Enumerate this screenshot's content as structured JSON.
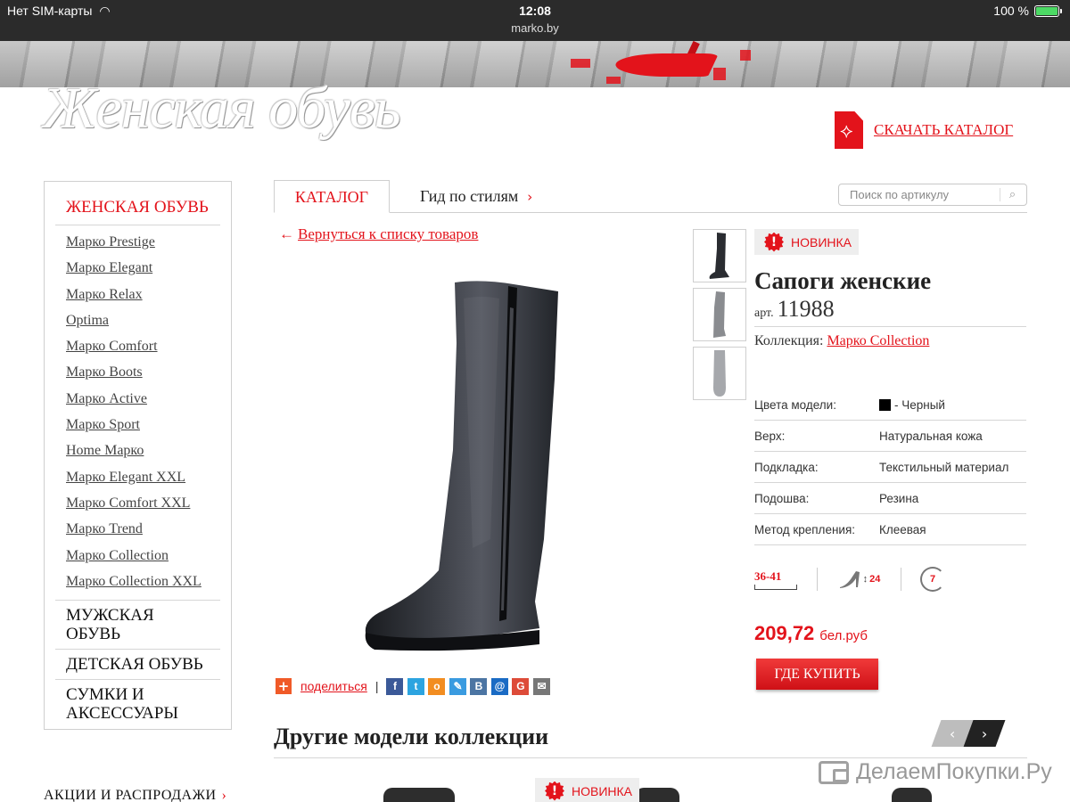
{
  "status_bar": {
    "carrier": "Нет SIM-карты",
    "time": "12:08",
    "url": "marko.by",
    "battery": "100 %"
  },
  "header": {
    "section_title": "Женская обувь",
    "catalog_download": "СКАЧАТЬ КАТАЛОГ"
  },
  "sidebar": {
    "active_section": "ЖЕНСКАЯ ОБУВЬ",
    "items": [
      "Марко Prestige",
      "Марко Elegant",
      "Марко Relax",
      "Optima",
      "Марко Comfort",
      "Марко Boots",
      "Марко Active",
      "Марко Sport",
      "Home Марко",
      "Марко Elegant XXL",
      "Марко Comfort XXL",
      "Марко Trend",
      "Марко Collection",
      "Марко Collection XXL"
    ],
    "sections": [
      "МУЖСКАЯ ОБУВЬ",
      "ДЕТСКАЯ ОБУВЬ",
      "СУМКИ И АКСЕССУАРЫ"
    ],
    "promo": "АКЦИИ И РАСПРОДАЖИ"
  },
  "tabs": {
    "catalog": "КАТАЛОГ",
    "style_guide": "Гид по стилям"
  },
  "search": {
    "placeholder": "Поиск по артикулу"
  },
  "back_link": "Вернуться к списку товаров",
  "share": {
    "label": "поделиться",
    "services": [
      {
        "name": "facebook-icon",
        "glyph": "f",
        "color": "#3b5998"
      },
      {
        "name": "twitter-icon",
        "glyph": "t",
        "color": "#2ca4e0"
      },
      {
        "name": "odnoklassniki-icon",
        "glyph": "o",
        "color": "#f28d21"
      },
      {
        "name": "livejournal-icon",
        "glyph": "✎",
        "color": "#3a9be0"
      },
      {
        "name": "vk-icon",
        "glyph": "B",
        "color": "#4c75a3"
      },
      {
        "name": "mailru-icon",
        "glyph": "@",
        "color": "#1a6bc4"
      },
      {
        "name": "googleplus-icon",
        "glyph": "G",
        "color": "#dd4b39"
      },
      {
        "name": "email-icon",
        "glyph": "✉",
        "color": "#777777"
      }
    ]
  },
  "product": {
    "badge": "НОВИНКА",
    "title": "Сапоги женские",
    "article_label": "арт.",
    "article": "11988",
    "collection_label": "Коллекция:",
    "collection": "Марко Collection",
    "specs": [
      {
        "key": "Цвета модели:",
        "value": "- Черный",
        "swatch": "#000000"
      },
      {
        "key": "Верх:",
        "value": "Натуральная кожа"
      },
      {
        "key": "Подкладка:",
        "value": "Текстильный материал"
      },
      {
        "key": "Подошва:",
        "value": "Резина"
      },
      {
        "key": "Метод крепления:",
        "value": "Клеевая"
      }
    ],
    "size_range": "36-41",
    "heel_height": "24",
    "rotation": "7",
    "price": "209,72",
    "currency": "бел.руб",
    "buy_button": "ГДЕ КУПИТЬ"
  },
  "other_models": {
    "title": "Другие модели коллекции",
    "badge": "НОВИНКА"
  },
  "watermark": "ДелаемПокупки.Ру",
  "colors": {
    "accent": "#e3131b",
    "status_bar": "#2b2b2b"
  }
}
